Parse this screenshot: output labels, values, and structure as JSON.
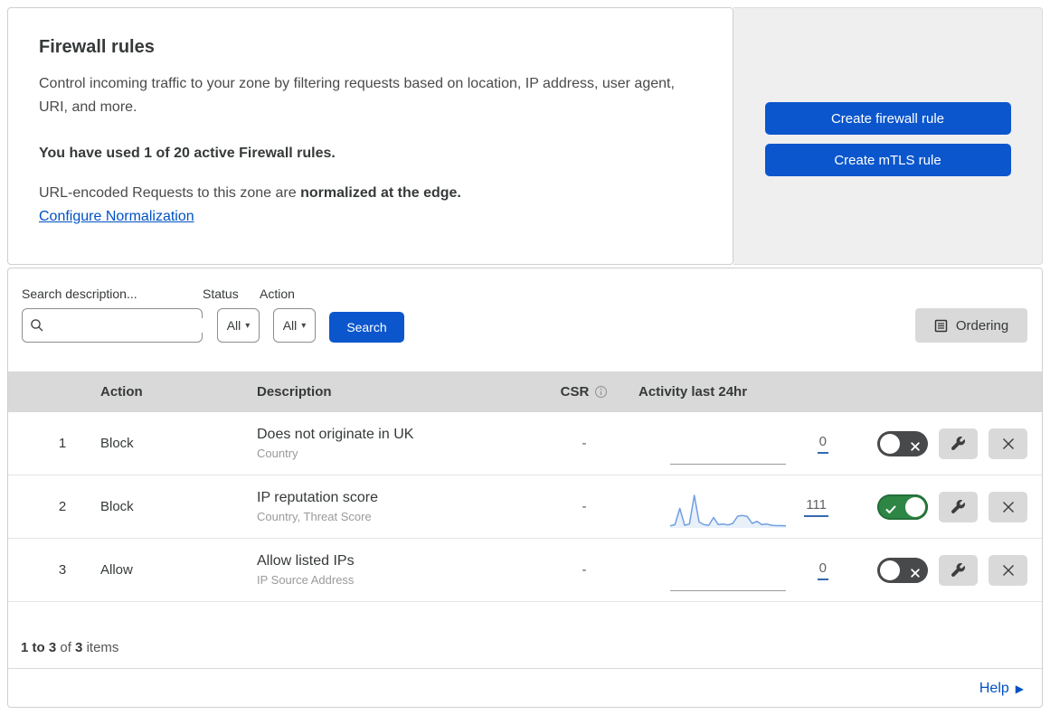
{
  "colors": {
    "button_blue": "#0b56cd",
    "link_blue": "#0051c3",
    "toggle_green": "#2e8644",
    "toggle_off_gray": "#48494b",
    "sparkline_blue": "#6f9fe0",
    "table_header_gray": "#d9d9d9"
  },
  "icons": {
    "dropdown_caret": "▾",
    "help_arrow": "▶",
    "search": "magnifier",
    "ordering": "list-page",
    "info": "circled-i",
    "edit": "wrench",
    "delete": "x",
    "toggle_on": "check",
    "toggle_off": "x"
  },
  "intro": {
    "title": "Firewall rules",
    "description": "Control incoming traffic to your zone by filtering requests based on location, IP address, user agent, URI, and more.",
    "usage": "You have used 1 of 20 active Firewall rules.",
    "normalization_prefix": "URL-encoded Requests to this zone are ",
    "normalization_bold": "normalized at the edge.",
    "normalization_link": "Configure Normalization"
  },
  "actions": {
    "create_firewall_rule": "Create firewall rule",
    "create_mtls_rule": "Create mTLS rule"
  },
  "filters": {
    "search_label": "Search description...",
    "status_label": "Status",
    "status_value": "All",
    "action_label": "Action",
    "action_value": "All",
    "search_button": "Search",
    "ordering_button": "Ordering"
  },
  "table_headers": {
    "action": "Action",
    "description": "Description",
    "csr": "CSR",
    "activity": "Activity last 24hr"
  },
  "rules": [
    {
      "priority": "1",
      "action": "Block",
      "description": "Does not originate in UK",
      "fields": "Country",
      "csr": "-",
      "count": "0",
      "enabled": false,
      "sparkline": null
    },
    {
      "priority": "2",
      "action": "Block",
      "description": "IP reputation score",
      "fields": "Country, Threat Score",
      "csr": "-",
      "count": "111",
      "enabled": true,
      "sparkline": [
        0.06,
        0.1,
        0.6,
        0.08,
        0.12,
        1.0,
        0.18,
        0.1,
        0.08,
        0.32,
        0.1,
        0.12,
        0.09,
        0.14,
        0.36,
        0.38,
        0.35,
        0.14,
        0.2,
        0.1,
        0.12,
        0.08,
        0.07,
        0.07,
        0.06
      ]
    },
    {
      "priority": "3",
      "action": "Allow",
      "description": "Allow listed IPs",
      "fields": "IP Source Address",
      "csr": "-",
      "count": "0",
      "enabled": false,
      "sparkline": null
    }
  ],
  "footer": {
    "range": "1 to 3",
    "of_word": "of",
    "total": "3",
    "items_word": "items"
  },
  "help": {
    "label": "Help"
  }
}
